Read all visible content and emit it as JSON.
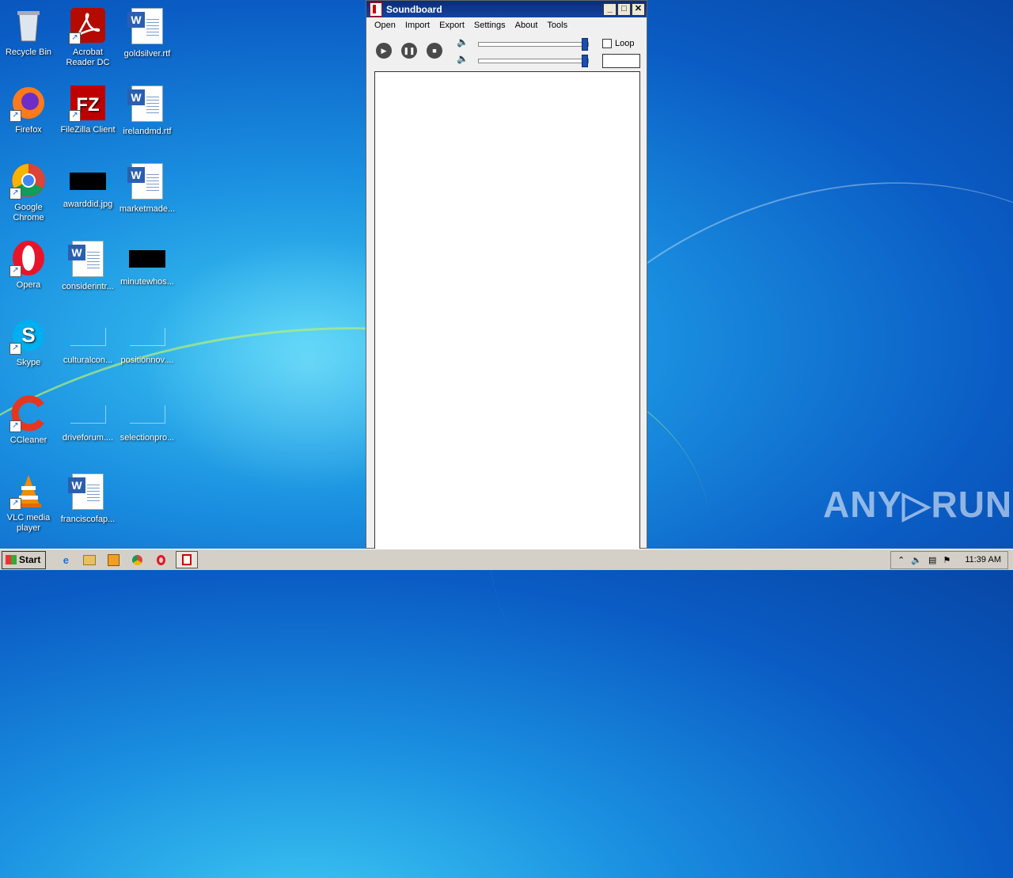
{
  "desktop": {
    "icons": [
      {
        "label": "Recycle Bin"
      },
      {
        "label": "Acrobat Reader DC"
      },
      {
        "label": "goldsilver.rtf"
      },
      {
        "label": "Firefox"
      },
      {
        "label": "FileZilla Client"
      },
      {
        "label": "irelandmd.rtf"
      },
      {
        "label": "Google Chrome"
      },
      {
        "label": "awarddid.jpg"
      },
      {
        "label": "marketmade..."
      },
      {
        "label": "Opera"
      },
      {
        "label": "considerintr..."
      },
      {
        "label": "minutewhos..."
      },
      {
        "label": "Skype"
      },
      {
        "label": "culturalcon..."
      },
      {
        "label": "positionnov...."
      },
      {
        "label": "CCleaner"
      },
      {
        "label": "driveforum...."
      },
      {
        "label": "selectionpro..."
      },
      {
        "label": "VLC media player"
      },
      {
        "label": "franciscofap..."
      }
    ],
    "watermark": "ANY▷RUN"
  },
  "window": {
    "title": "Soundboard",
    "menu": [
      "Open",
      "Import",
      "Export",
      "Settings",
      "About",
      "Tools"
    ],
    "loop_label": "Loop",
    "loop_checked": false,
    "volume_level": 1.0,
    "secondary_level": 1.0,
    "accent_color": "#1a4fb0"
  },
  "taskbar": {
    "start_label": "Start",
    "clock": "11:39 AM"
  }
}
